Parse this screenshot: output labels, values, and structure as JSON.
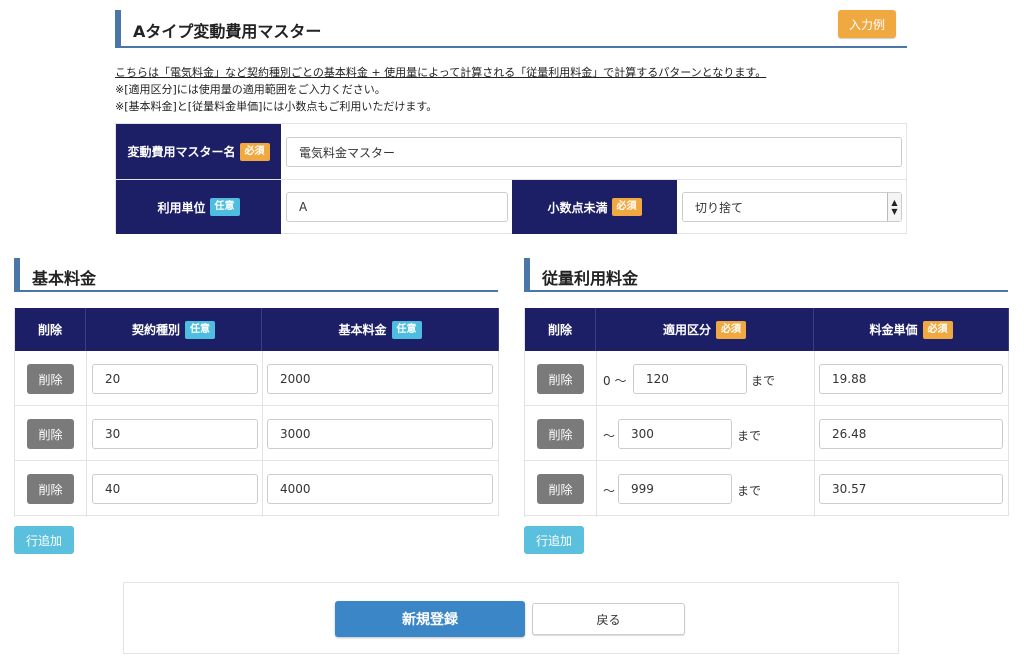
{
  "page": {
    "title": "Aタイプ変動費用マスター",
    "example_button": "入力例",
    "description": [
      "こちらは「電気料金」など契約種別ごとの基本料金 + 使用量によって計算される「従量利用料金」で計算するパターンとなります。",
      "※[適用区分]には使用量の適用範囲をご入力ください。",
      "※[基本料金]と[従量料金単価]には小数点もご利用いただけます。"
    ]
  },
  "form": {
    "name_label": "変動費用マスター名",
    "name_badge": "必須",
    "name_value": "電気料金マスター",
    "unit_label": "利用単位",
    "unit_badge": "任意",
    "unit_value": "A",
    "decimal_label": "小数点未満",
    "decimal_badge": "必須",
    "decimal_value": "切り捨て"
  },
  "basic": {
    "title": "基本料金",
    "headers": {
      "delete": "削除",
      "contract": "契約種別",
      "contract_badge": "任意",
      "fee": "基本料金",
      "fee_badge": "任意"
    },
    "rows": [
      {
        "delete": "削除",
        "contract": "20",
        "fee": "2000"
      },
      {
        "delete": "削除",
        "contract": "30",
        "fee": "3000"
      },
      {
        "delete": "削除",
        "contract": "40",
        "fee": "4000"
      }
    ],
    "add_button": "行追加"
  },
  "usage": {
    "title": "従量利用料金",
    "headers": {
      "delete": "削除",
      "range": "適用区分",
      "range_badge": "必須",
      "price": "料金単価",
      "price_badge": "必須"
    },
    "rows": [
      {
        "delete": "削除",
        "from": "0 〜",
        "to": "120",
        "suffix": "まで",
        "price": "19.88"
      },
      {
        "delete": "削除",
        "from": "〜",
        "to": "300",
        "suffix": "まで",
        "price": "26.48"
      },
      {
        "delete": "削除",
        "from": "〜",
        "to": "999",
        "suffix": "まで",
        "price": "30.57"
      }
    ],
    "add_button": "行追加"
  },
  "footer": {
    "submit": "新規登録",
    "back": "戻る"
  }
}
